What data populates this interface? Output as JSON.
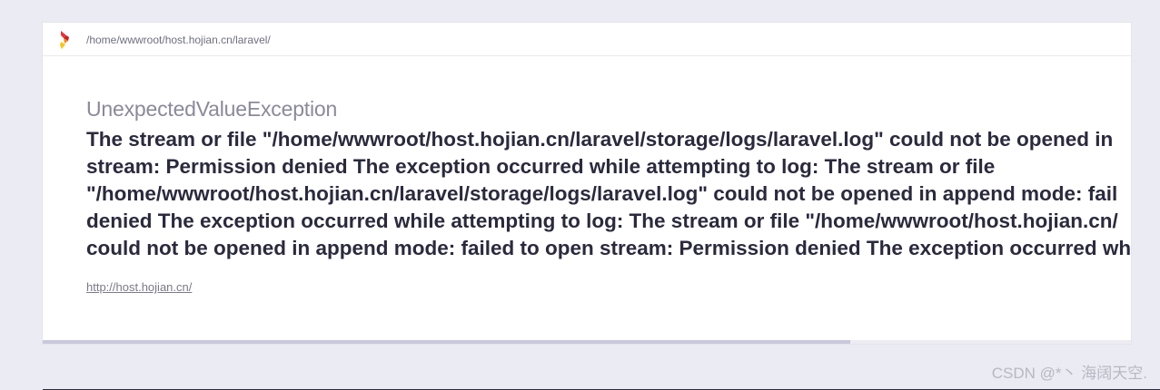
{
  "header": {
    "logo_icon": "laravel-ignition-logo-icon",
    "path": "/home/wwwroot/host.hojian.cn/laravel/"
  },
  "exception": {
    "class": "UnexpectedValueException",
    "message_lines": [
      "The stream or file \"/home/wwwroot/host.hojian.cn/laravel/storage/logs/laravel.log\" could not be opened in",
      "stream: Permission denied The exception occurred while attempting to log: The stream or file",
      "\"/home/wwwroot/host.hojian.cn/laravel/storage/logs/laravel.log\" could not be opened in append mode: fail",
      "denied The exception occurred while attempting to log: The stream or file \"/home/wwwroot/host.hojian.cn/",
      "could not be opened in append mode: failed to open stream: Permission denied The exception occurred wh"
    ]
  },
  "request": {
    "url": "http://host.hojian.cn/"
  },
  "scrollbar": {
    "thumb_fraction": 0.742
  },
  "watermark": {
    "text": "CSDN @*丶 海阔天空."
  }
}
